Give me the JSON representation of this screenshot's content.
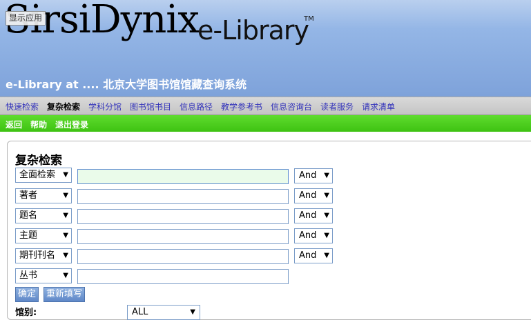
{
  "header": {
    "logo_main": "SirsiDynix",
    "logo_sub": "e-Library",
    "logo_tm": "TM",
    "show_app_button": "显示应用",
    "site_title": "e-Library at .... 北京大学图书馆馆藏查询系统"
  },
  "nav": {
    "items": [
      {
        "label": "快速检索",
        "active": false
      },
      {
        "label": "复杂检索",
        "active": true
      },
      {
        "label": "学科分馆",
        "active": false
      },
      {
        "label": "图书馆书目",
        "active": false
      },
      {
        "label": "信息路径",
        "active": false
      },
      {
        "label": "教学参考书",
        "active": false
      },
      {
        "label": "信息咨询台",
        "active": false
      },
      {
        "label": "读者服务",
        "active": false
      },
      {
        "label": "请求清单",
        "active": false
      }
    ]
  },
  "actions": {
    "items": [
      {
        "label": "返回"
      },
      {
        "label": "帮助"
      },
      {
        "label": "退出登录"
      }
    ]
  },
  "search": {
    "heading": "复杂检索",
    "rows": [
      {
        "field": "全面检索",
        "value": "",
        "bool": "And"
      },
      {
        "field": "著者",
        "value": "",
        "bool": "And"
      },
      {
        "field": "题名",
        "value": "",
        "bool": "And"
      },
      {
        "field": "主题",
        "value": "",
        "bool": "And"
      },
      {
        "field": "期刊刊名",
        "value": "",
        "bool": "And"
      },
      {
        "field": "丛书",
        "value": ""
      }
    ],
    "submit_label": "确定",
    "reset_label": "重新填写",
    "library_label": "馆别:",
    "library_value": "ALL"
  },
  "colors": {
    "banner": "#7ea2da",
    "nav_link": "#3333bb",
    "green_bar": "#3ec212",
    "focused_input": "#eafbea"
  }
}
